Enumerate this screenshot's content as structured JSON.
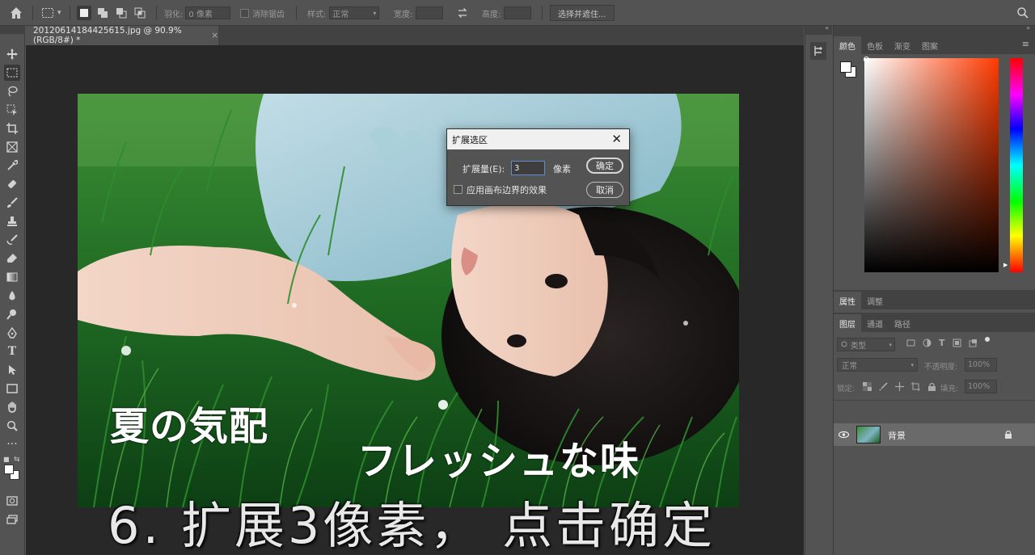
{
  "options_bar": {
    "feather_label": "羽化:",
    "feather_value": "0 像素",
    "antialias_label": "消除锯齿",
    "style_label": "样式:",
    "style_value": "正常",
    "width_label": "宽度:",
    "height_label": "高度:",
    "select_mask_button": "选择并遮住..."
  },
  "document": {
    "tab_title": "20120614184425615.jpg @ 90.9%(RGB/8#) *",
    "close_glyph": "×"
  },
  "photo_overlay": {
    "line1": "夏の気配",
    "line2": "フレッシュな味"
  },
  "subtitle": "6. 扩展3像素， 点击确定",
  "dialog": {
    "title": "扩展选区",
    "close_glyph": "✕",
    "amount_label": "扩展量(E):",
    "amount_value": "3",
    "unit": "像素",
    "checkbox_label": "应用画布边界的效果",
    "ok_button": "确定",
    "cancel_button": "取消"
  },
  "color_panel": {
    "tabs": [
      "颜色",
      "色板",
      "渐变",
      "图案"
    ],
    "active_tab": "颜色"
  },
  "props_panel": {
    "tabs": [
      "属性",
      "调整"
    ]
  },
  "layers_panel": {
    "tabs": [
      "图层",
      "通道",
      "路径"
    ],
    "kind_filter": "类型",
    "blend_mode": "正常",
    "opacity_label": "不透明度:",
    "opacity_value": "100%",
    "lock_label": "锁定:",
    "fill_label": "填充:",
    "fill_value": "100%",
    "layers": [
      {
        "name": "背景",
        "visible": true,
        "locked": true
      }
    ]
  },
  "colors": {
    "ui_bg": "#535353",
    "canvas_bg": "#282828",
    "grass": "#1e6b22",
    "hue_spectrum": "#ff3a00"
  }
}
